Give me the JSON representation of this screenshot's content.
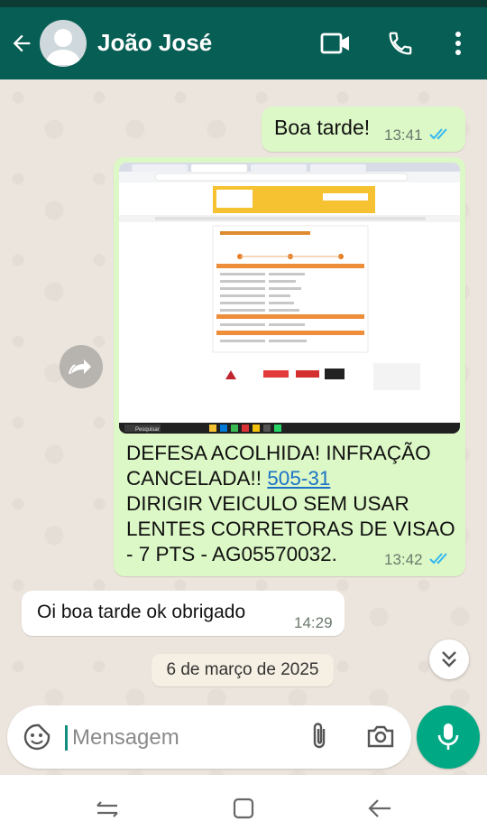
{
  "contact": {
    "name": "João José"
  },
  "messages": {
    "m1": {
      "text": "Boa tarde!",
      "time": "13:41"
    },
    "m2": {
      "line1": "DEFESA ACOLHIDA! INFRAÇÃO",
      "line2_prefix": "CANCELADA!! ",
      "link": "505-31",
      "line3": "DIRIGIR VEICULO SEM USAR",
      "line4": "LENTES CORRETORAS DE VISAO",
      "line5": "- 7 PTS - AG05570032.",
      "time": "13:42"
    },
    "m3": {
      "text": "Oi boa tarde ok obrigado",
      "time": "14:29"
    }
  },
  "date_separator": "6 de março de 2025",
  "composer": {
    "placeholder": "Mensagem"
  },
  "screenshot": {
    "taskbar_search": "Pesquisar"
  },
  "colors": {
    "header": "#075e54",
    "outgoing_bubble": "#dcf8c6",
    "incoming_bubble": "#ffffff",
    "read_ticks": "#34b7f1",
    "mic_button": "#00a884"
  }
}
